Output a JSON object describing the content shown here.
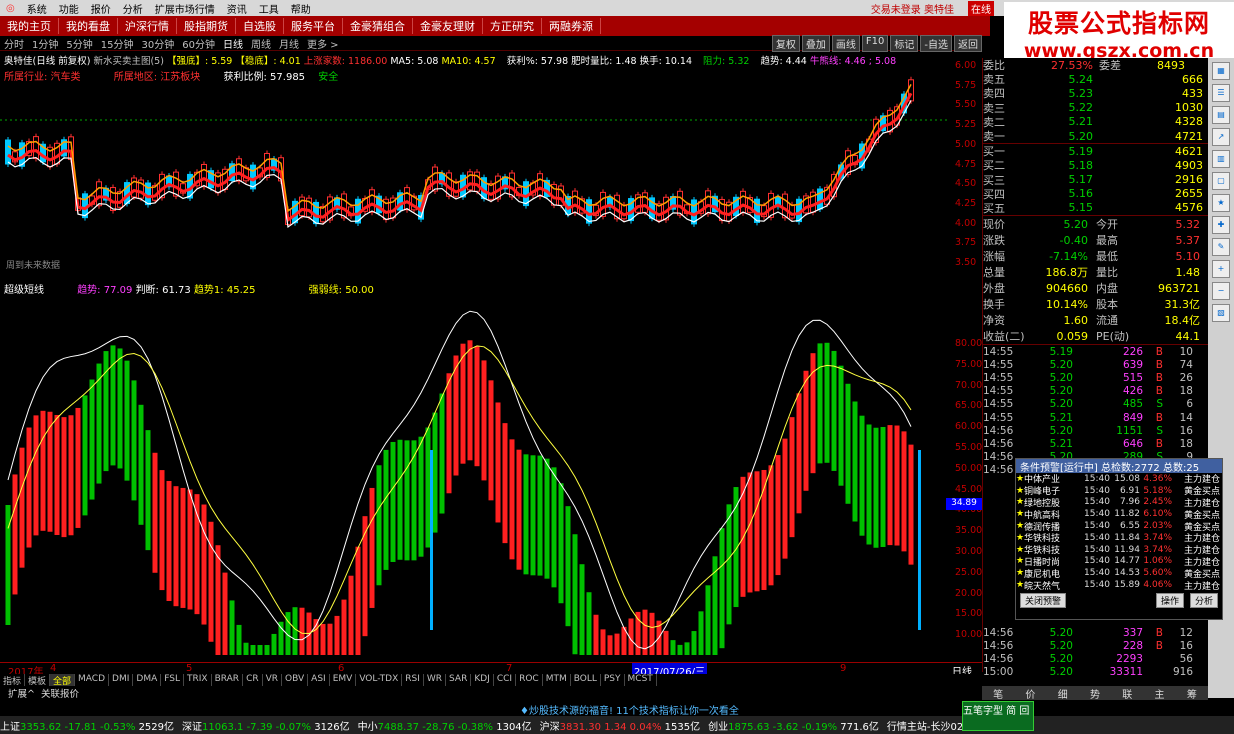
{
  "menubar": {
    "items": [
      "系统",
      "功能",
      "报价",
      "分析",
      "扩展市场行情",
      "资讯",
      "工具",
      "帮助"
    ],
    "account": "交易未登录 奥特佳",
    "status": "在线"
  },
  "navbar": [
    "我的主页",
    "我的看盘",
    "沪深行情",
    "股指期货",
    "自选股",
    "服务平台",
    "金豪猜组合",
    "金豪友理财",
    "方正研究",
    "两融券源"
  ],
  "watermark": {
    "line1": "股票公式指标网",
    "line2": "www.gszx.com.cn"
  },
  "periods": [
    "分时",
    "1分钟",
    "5分钟",
    "15分钟",
    "30分钟",
    "60分钟",
    "日线",
    "周线",
    "月线",
    "更多 >"
  ],
  "active_period": "日线",
  "tools": [
    "复权",
    "叠加",
    "画线",
    "F10",
    "标记",
    "-自选",
    "返回"
  ],
  "info": {
    "stock": "奥特佳(日线 前复权)",
    "main": "新水买卖主图(5)",
    "s1": "【强底】: 5.59",
    "s2": "【稳底】: 4.01",
    "s3": "上涨家数: 1186.00",
    "ma5": "MA5: 5.08",
    "ma10": "MA10: 4.57",
    "profit": "获利%: 57.98",
    "ratio": "肥时量比: 1.48",
    "turn": "换手: 10.14",
    "res": "阻力: 5.32",
    "trend": "趋势: 4.44",
    "line": "牛熊线: 4.46 ; 5.08",
    "ind": "所属行业: 汽车类",
    "area": "所属地区: 江苏板块",
    "pr": "获利比例: 57.985",
    "safe": "安全",
    "note": "周到未来数据",
    "sub": "超级短线",
    "i1": "趋势: 77.09",
    "i2": "判断: 61.73",
    "i3": "趋势1: 45.25",
    "i4": "强弱线: 50.00"
  },
  "price_axis": [
    "6.00",
    "5.75",
    "5.50",
    "5.25",
    "5.00",
    "4.75",
    "4.50",
    "4.25",
    "4.00",
    "3.75",
    "3.50"
  ],
  "osc_axis": [
    "80.00",
    "75.00",
    "70.00",
    "65.00",
    "60.00",
    "55.00",
    "50.00",
    "45.00",
    "40.00",
    "35.00",
    "30.00",
    "25.00",
    "20.00",
    "15.00",
    "10.00"
  ],
  "cursor_value": "34.89",
  "dates": {
    "year": "2017年",
    "m4": "4",
    "m5": "5",
    "m6": "6",
    "m7": "7",
    "m9": "9",
    "cur": "2017/07/26/三",
    "sel": "日线"
  },
  "indicators": [
    "指标",
    "模板",
    "全部",
    "MACD",
    "DMI",
    "DMA",
    "FSL",
    "TRIX",
    "BRAR",
    "CR",
    "VR",
    "OBV",
    "ASI",
    "EMV",
    "VOL-TDX",
    "RSI",
    "WR",
    "SAR",
    "KDJ",
    "CCI",
    "ROC",
    "MTM",
    "BOLL",
    "PSY",
    "MCST"
  ],
  "expand": [
    "扩展^",
    "关联报价"
  ],
  "promo": "♦炒股技术源的福音! 11个技术指标让你一次看全",
  "ticker": [
    {
      "n": "上证",
      "p": "3353.62",
      "c": "-17.81",
      "r": "-0.53%",
      "v": "2529亿"
    },
    {
      "n": "深证",
      "p": "11063.1",
      "c": "-7.39",
      "r": "-0.07%",
      "v": "3126亿"
    },
    {
      "n": "中小",
      "p": "7488.37",
      "c": "-28.76",
      "r": "-0.38%",
      "v": "1304亿"
    },
    {
      "n": "沪深",
      "p": "3831.30",
      "c": "1.34",
      "r": "0.04%",
      "v": "1535亿"
    },
    {
      "n": "创业",
      "p": "1875.63",
      "c": "-3.62",
      "r": "-0.19%",
      "v": "771.6亿"
    }
  ],
  "ticker_extra": "行情主站-长沙02",
  "orderbook": {
    "wb": {
      "l": "委比",
      "p": "27.53%",
      "m": "委差",
      "v": "8493"
    },
    "sell": [
      {
        "l": "卖五",
        "p": "5.24",
        "v": "666"
      },
      {
        "l": "卖四",
        "p": "5.23",
        "v": "433"
      },
      {
        "l": "卖三",
        "p": "5.22",
        "v": "1030"
      },
      {
        "l": "卖二",
        "p": "5.21",
        "v": "4328"
      },
      {
        "l": "卖一",
        "p": "5.20",
        "v": "4721"
      }
    ],
    "buy": [
      {
        "l": "买一",
        "p": "5.19",
        "v": "4621"
      },
      {
        "l": "买二",
        "p": "5.18",
        "v": "4903"
      },
      {
        "l": "买三",
        "p": "5.17",
        "v": "2916"
      },
      {
        "l": "买四",
        "p": "5.16",
        "v": "2655"
      },
      {
        "l": "买五",
        "p": "5.15",
        "v": "4576"
      }
    ]
  },
  "quote": [
    [
      "现价",
      "5.20",
      "今开",
      "5.32"
    ],
    [
      "涨跌",
      "-0.40",
      "最高",
      "5.37"
    ],
    [
      "涨幅",
      "-7.14%",
      "最低",
      "5.10"
    ],
    [
      "总量",
      "186.8万",
      "量比",
      "1.48"
    ],
    [
      "外盘",
      "904660",
      "内盘",
      "963721"
    ],
    [
      "换手",
      "10.14%",
      "股本",
      "31.3亿"
    ],
    [
      "净资",
      "1.60",
      "流通",
      "18.4亿"
    ],
    [
      "收益(二)",
      "0.059",
      "PE(动)",
      "44.1"
    ]
  ],
  "ticks": [
    [
      "14:55",
      "5.19",
      "226",
      "B",
      "10"
    ],
    [
      "14:55",
      "5.20",
      "639",
      "B",
      "74"
    ],
    [
      "14:55",
      "5.20",
      "515",
      "B",
      "26"
    ],
    [
      "14:55",
      "5.20",
      "426",
      "B",
      "18"
    ],
    [
      "14:55",
      "5.20",
      "485",
      "S",
      "6"
    ],
    [
      "14:55",
      "5.21",
      "849",
      "B",
      "14"
    ],
    [
      "14:56",
      "5.20",
      "1151",
      "S",
      "16"
    ],
    [
      "14:56",
      "5.21",
      "646",
      "B",
      "18"
    ],
    [
      "14:56",
      "5.20",
      "289",
      "S",
      "9"
    ],
    [
      "14:56",
      "5.20",
      "491",
      "S",
      "13"
    ]
  ],
  "ticks_tail": [
    [
      "14:56",
      "5.20",
      "337",
      "B",
      "12"
    ],
    [
      "14:56",
      "5.20",
      "228",
      "B",
      "16"
    ],
    [
      "14:56",
      "5.20",
      "2293",
      "",
      "56"
    ],
    [
      "15:00",
      "5.20",
      "33311",
      "",
      "916"
    ]
  ],
  "alert": {
    "title": "条件预警[运行中] 总检数:2772 总数:25",
    "rows": [
      [
        "中体产业",
        "15:40",
        "15.08",
        "4.36%",
        "主力建仓"
      ],
      [
        "铜峰电子",
        "15:40",
        "6.91",
        "5.18%",
        "黄金买点"
      ],
      [
        "绿地控股",
        "15:40",
        "7.96",
        "2.45%",
        "主力建仓"
      ],
      [
        "中航高科",
        "15:40",
        "11.82",
        "6.10%",
        "黄金买点"
      ],
      [
        "德润传播",
        "15:40",
        "6.55",
        "2.03%",
        "黄金买点"
      ],
      [
        "华铁科技",
        "15:40",
        "11.84",
        "3.74%",
        "主力建仓"
      ],
      [
        "华铁科技",
        "15:40",
        "11.94",
        "3.74%",
        "主力建仓"
      ],
      [
        "日播时尚",
        "15:40",
        "14.77",
        "1.06%",
        "主力建仓"
      ],
      [
        "康尼机电",
        "15:40",
        "14.53",
        "5.60%",
        "黄金买点"
      ],
      [
        "皖天然气",
        "15:40",
        "15.89",
        "4.06%",
        "主力建仓"
      ]
    ],
    "close": "关闭预警",
    "op": "操作",
    "an": "分析"
  },
  "bottomtabs": [
    "笔",
    "价",
    "细",
    "势",
    "联",
    "主",
    "筹"
  ],
  "hq": "五笔字型 简 回"
}
